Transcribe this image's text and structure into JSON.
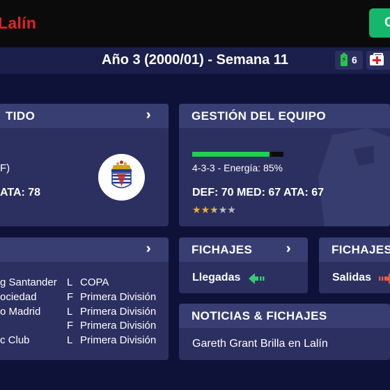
{
  "header": {
    "club_name": "Lalín",
    "action_label": "C"
  },
  "week_bar": {
    "title": "Año 3 (2000/01) - Semana 11",
    "energy_count": "6"
  },
  "partido": {
    "title": "TIDO",
    "line1": "F)",
    "line2": " ATA: 78"
  },
  "gestion": {
    "title": "GESTIÓN DEL EQUIPO",
    "energy_fraction": 0.85,
    "formation": "4-3-3 - Energía: 85%",
    "ratings": "DEF: 70 MED: 67 ATA: 67",
    "stars": 2.5,
    "stars_max": 5
  },
  "calendar": {
    "rows": [
      {
        "team": "g Santander",
        "venue": "L",
        "competition": "COPA"
      },
      {
        "team": "ociedad",
        "venue": "F",
        "competition": "Primera División"
      },
      {
        "team": "o Madrid",
        "venue": "L",
        "competition": "Primera División"
      },
      {
        "team": "",
        "venue": "F",
        "competition": "Primera División"
      },
      {
        "team": "c Club",
        "venue": "L",
        "competition": "Primera División"
      }
    ]
  },
  "fichajes_llegadas": {
    "title": "FICHAJES",
    "label": "Llegadas"
  },
  "fichajes_salidas": {
    "title": "FICHAJES",
    "label": "Salidas"
  },
  "noticias": {
    "title": "NOTICIAS & FICHAJES",
    "headline": "Gareth Grant Brilla en Lalín"
  },
  "colors": {
    "brand_red": "#e8202a",
    "action_green": "#15b86a",
    "energy_green": "#1dd34c",
    "panel": "#2b3060",
    "panel_header": "#383e72",
    "background": "#0e1238",
    "star": "#f0b323"
  }
}
